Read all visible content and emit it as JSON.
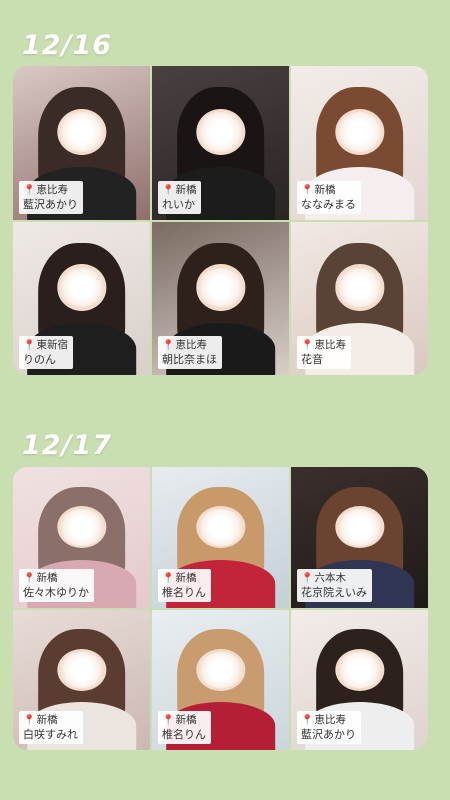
{
  "sections": [
    {
      "date": "12/16",
      "cards": [
        {
          "area": "恵比寿",
          "name": "藍沢あかり",
          "bg": [
            "#d9c9c4",
            "#8f6f6c"
          ],
          "hair": "#3a2b26",
          "outfit": "#222222"
        },
        {
          "area": "新橋",
          "name": "れいか",
          "bg": [
            "#4a4040",
            "#2b2424"
          ],
          "hair": "#1a1414",
          "outfit": "#1c1c1c"
        },
        {
          "area": "新橋",
          "name": "ななみまる",
          "bg": [
            "#f2ece8",
            "#e2d6d0"
          ],
          "hair": "#7a4a32",
          "outfit": "#f6eeee"
        },
        {
          "area": "東新宿",
          "name": "りのん",
          "bg": [
            "#efe9e6",
            "#d8cfc9"
          ],
          "hair": "#2a1f1c",
          "outfit": "#1e1e1e"
        },
        {
          "area": "恵比寿",
          "name": "朝比奈まほ",
          "bg": [
            "#7a6a62",
            "#d8cfc8"
          ],
          "hair": "#2e211c",
          "outfit": "#1a1a1a"
        },
        {
          "area": "恵比寿",
          "name": "花音",
          "bg": [
            "#f1e9e4",
            "#dac9c0"
          ],
          "hair": "#5b4236",
          "outfit": "#f4ece6"
        }
      ]
    },
    {
      "date": "12/17",
      "cards": [
        {
          "area": "新橋",
          "name": "佐々木ゆりか",
          "bg": [
            "#f0e2e2",
            "#e4c9cc"
          ],
          "hair": "#8a6f6a",
          "outfit": "#d9a9b3"
        },
        {
          "area": "新橋",
          "name": "椎名りん",
          "bg": [
            "#e7ecef",
            "#c3cfd8"
          ],
          "hair": "#c89a6a",
          "outfit": "#c2243a"
        },
        {
          "area": "六本木",
          "name": "花京院えいみ",
          "bg": [
            "#3a2f2c",
            "#1f1a18"
          ],
          "hair": "#6b4431",
          "outfit": "#2f3553"
        },
        {
          "area": "新橋",
          "name": "白咲すみれ",
          "bg": [
            "#e8dcd8",
            "#cbb8b1"
          ],
          "hair": "#5a3c30",
          "outfit": "#ece4df"
        },
        {
          "area": "新橋",
          "name": "椎名りん",
          "bg": [
            "#e9eef0",
            "#cbd6dc"
          ],
          "hair": "#c99c70",
          "outfit": "#b51f35"
        },
        {
          "area": "恵比寿",
          "name": "藍沢あかり",
          "bg": [
            "#f2ece9",
            "#ded3cd"
          ],
          "hair": "#2c211d",
          "outfit": "#eeeeee"
        }
      ]
    }
  ]
}
